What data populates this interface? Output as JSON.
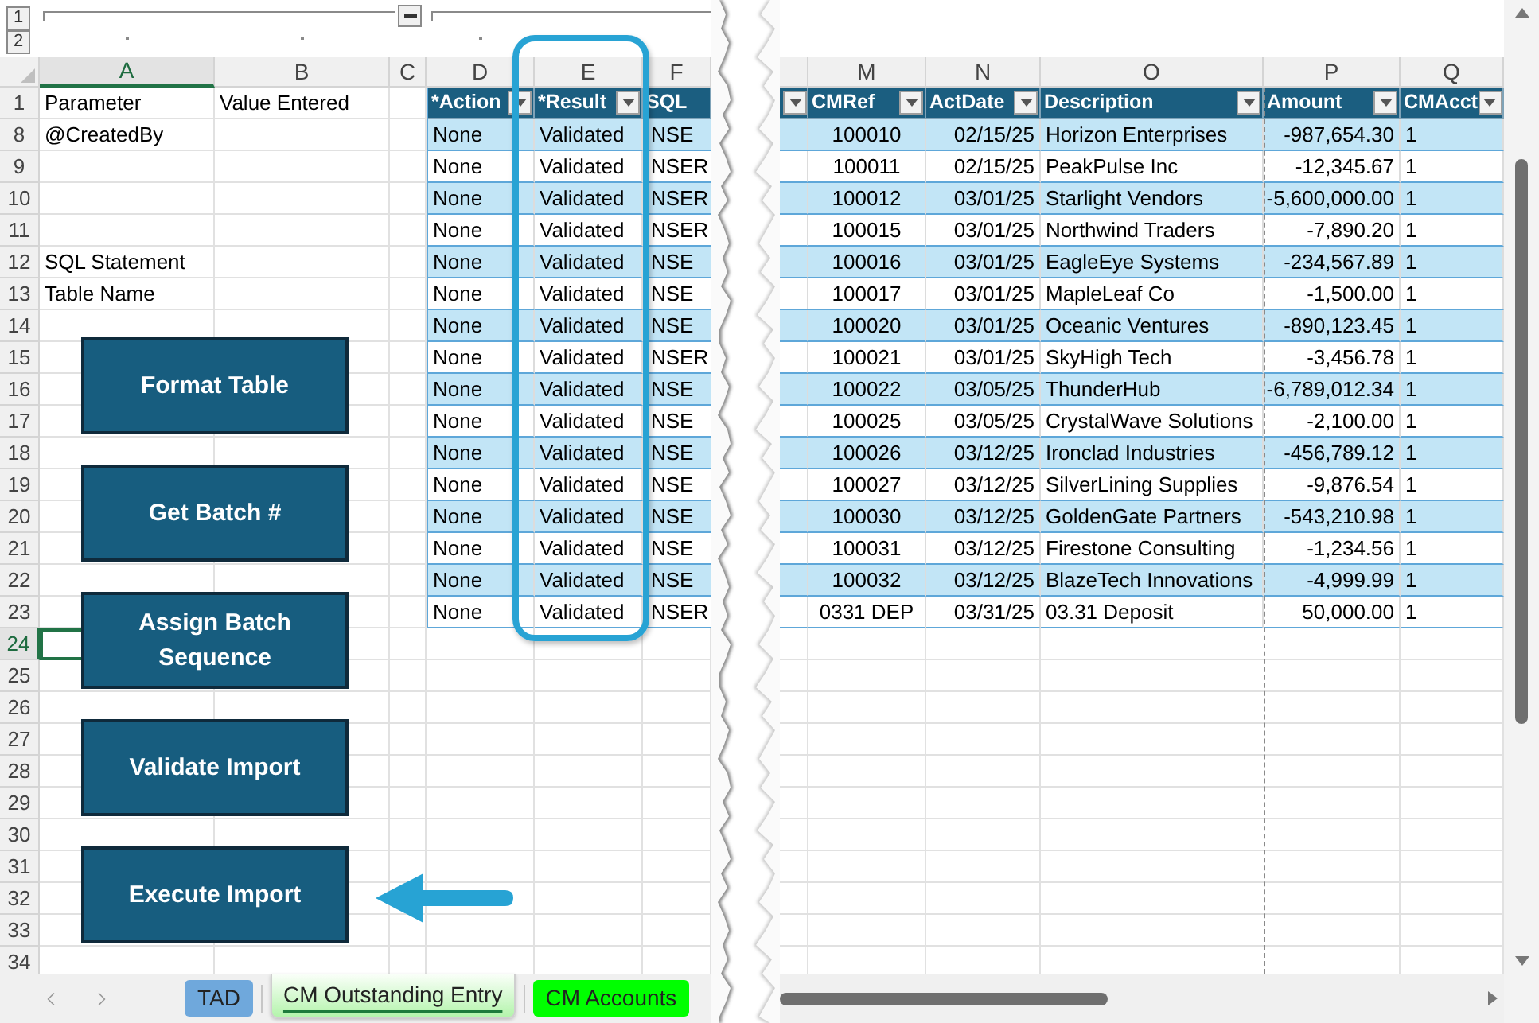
{
  "outline": {
    "levels": [
      "1",
      "2"
    ]
  },
  "columns_left": [
    {
      "letter": "A",
      "selected": true
    },
    {
      "letter": "B",
      "selected": false
    },
    {
      "letter": "C",
      "selected": false
    },
    {
      "letter": "D",
      "selected": false
    },
    {
      "letter": "E",
      "selected": false
    },
    {
      "letter": "F",
      "selected": false
    }
  ],
  "columns_right": [
    {
      "letter": "M",
      "selected": false
    },
    {
      "letter": "N",
      "selected": false
    },
    {
      "letter": "O",
      "selected": false
    },
    {
      "letter": "P",
      "selected": false
    },
    {
      "letter": "Q",
      "selected": false
    }
  ],
  "rows": [
    {
      "number": "1",
      "selected": false,
      "parameter": "Parameter",
      "value": "Value Entered"
    },
    {
      "number": "8",
      "selected": false,
      "parameter": "@CreatedBy"
    },
    {
      "number": "9",
      "selected": false
    },
    {
      "number": "10",
      "selected": false
    },
    {
      "number": "11",
      "selected": false
    },
    {
      "number": "12",
      "selected": false,
      "parameter": "SQL Statement"
    },
    {
      "number": "13",
      "selected": false,
      "parameter": "Table Name"
    },
    {
      "number": "14",
      "selected": false
    },
    {
      "number": "15",
      "selected": false
    },
    {
      "number": "16",
      "selected": false
    },
    {
      "number": "17",
      "selected": false
    },
    {
      "number": "18",
      "selected": false
    },
    {
      "number": "19",
      "selected": false
    },
    {
      "number": "20",
      "selected": false
    },
    {
      "number": "21",
      "selected": false
    },
    {
      "number": "22",
      "selected": false
    },
    {
      "number": "23",
      "selected": false
    },
    {
      "number": "24",
      "selected": true
    },
    {
      "number": "25",
      "selected": false
    },
    {
      "number": "26",
      "selected": false
    },
    {
      "number": "27",
      "selected": false
    },
    {
      "number": "28",
      "selected": false
    },
    {
      "number": "29",
      "selected": false
    },
    {
      "number": "30",
      "selected": false
    },
    {
      "number": "31",
      "selected": false
    },
    {
      "number": "32",
      "selected": false
    },
    {
      "number": "33",
      "selected": false
    },
    {
      "number": "34",
      "selected": false
    }
  ],
  "import_table": {
    "columns": [
      {
        "title": "*Action",
        "filter": true
      },
      {
        "title": "*Result",
        "filter": true
      },
      {
        "title": "SQL"
      }
    ],
    "rows": [
      [
        "None",
        "Validated",
        "NSE"
      ],
      [
        "None",
        "Validated",
        "NSER"
      ],
      [
        "None",
        "Validated",
        "NSER"
      ],
      [
        "None",
        "Validated",
        "NSER"
      ],
      [
        "None",
        "Validated",
        "NSE"
      ],
      [
        "None",
        "Validated",
        "NSE"
      ],
      [
        "None",
        "Validated",
        "NSE"
      ],
      [
        "None",
        "Validated",
        "NSER"
      ],
      [
        "None",
        "Validated",
        "NSE"
      ],
      [
        "None",
        "Validated",
        "NSE"
      ],
      [
        "None",
        "Validated",
        "NSE"
      ],
      [
        "None",
        "Validated",
        "NSE"
      ],
      [
        "None",
        "Validated",
        "NSE"
      ],
      [
        "None",
        "Validated",
        "NSE"
      ],
      [
        "None",
        "Validated",
        "NSE"
      ],
      [
        "None",
        "Validated",
        "NSER"
      ]
    ]
  },
  "entry_table": {
    "columns": [
      {
        "filter": true
      },
      {
        "title": "CMRef",
        "filter": true
      },
      {
        "title": "ActDate",
        "filter": true
      },
      {
        "title": "Description",
        "filter": true
      },
      {
        "title": "Amount",
        "filter": true
      },
      {
        "title": "CMAcct",
        "filter": true
      }
    ],
    "rows": [
      [
        "",
        "100010",
        "02/15/25",
        "Horizon Enterprises",
        "-987,654.30",
        "1"
      ],
      [
        "",
        "100011",
        "02/15/25",
        "PeakPulse Inc",
        "-12,345.67",
        "1"
      ],
      [
        "",
        "100012",
        "03/01/25",
        "Starlight Vendors",
        "-5,600,000.00",
        "1"
      ],
      [
        "",
        "100015",
        "03/01/25",
        "Northwind Traders",
        "-7,890.20",
        "1"
      ],
      [
        "",
        "100016",
        "03/01/25",
        "EagleEye Systems",
        "-234,567.89",
        "1"
      ],
      [
        "",
        "100017",
        "03/01/25",
        "MapleLeaf Co",
        "-1,500.00",
        "1"
      ],
      [
        "",
        "100020",
        "03/01/25",
        "Oceanic Ventures",
        "-890,123.45",
        "1"
      ],
      [
        "",
        "100021",
        "03/01/25",
        "SkyHigh Tech",
        "-3,456.78",
        "1"
      ],
      [
        "",
        "100022",
        "03/05/25",
        "ThunderHub",
        "-6,789,012.34",
        "1"
      ],
      [
        "",
        "100025",
        "03/05/25",
        "CrystalWave Solutions",
        "-2,100.00",
        "1"
      ],
      [
        "",
        "100026",
        "03/12/25",
        "Ironclad Industries",
        "-456,789.12",
        "1"
      ],
      [
        "",
        "100027",
        "03/12/25",
        "SilverLining Supplies",
        "-9,876.54",
        "1"
      ],
      [
        "",
        "100030",
        "03/12/25",
        "GoldenGate Partners",
        "-543,210.98",
        "1"
      ],
      [
        "",
        "100031",
        "03/12/25",
        "Firestone Consulting",
        "-1,234.56",
        "1"
      ],
      [
        "",
        "100032",
        "03/12/25",
        "BlazeTech Innovations",
        "-4,999.99",
        "1"
      ],
      [
        "",
        "0331 DEP",
        "03/31/25",
        "03.31 Deposit",
        "50,000.00",
        "1"
      ]
    ]
  },
  "macro_buttons": [
    "Format Table",
    "Get Batch #",
    "Assign Batch Sequence",
    "Validate Import",
    "Execute Import"
  ],
  "sheet_tabs": [
    {
      "label": "TAD",
      "selected": false,
      "color": "#6fa8dc"
    },
    {
      "label": "CM Outstanding Entry",
      "selected": true,
      "color": "#b4f4ac"
    },
    {
      "label": "CM Accounts",
      "selected": false,
      "color": "#00ff00"
    }
  ]
}
